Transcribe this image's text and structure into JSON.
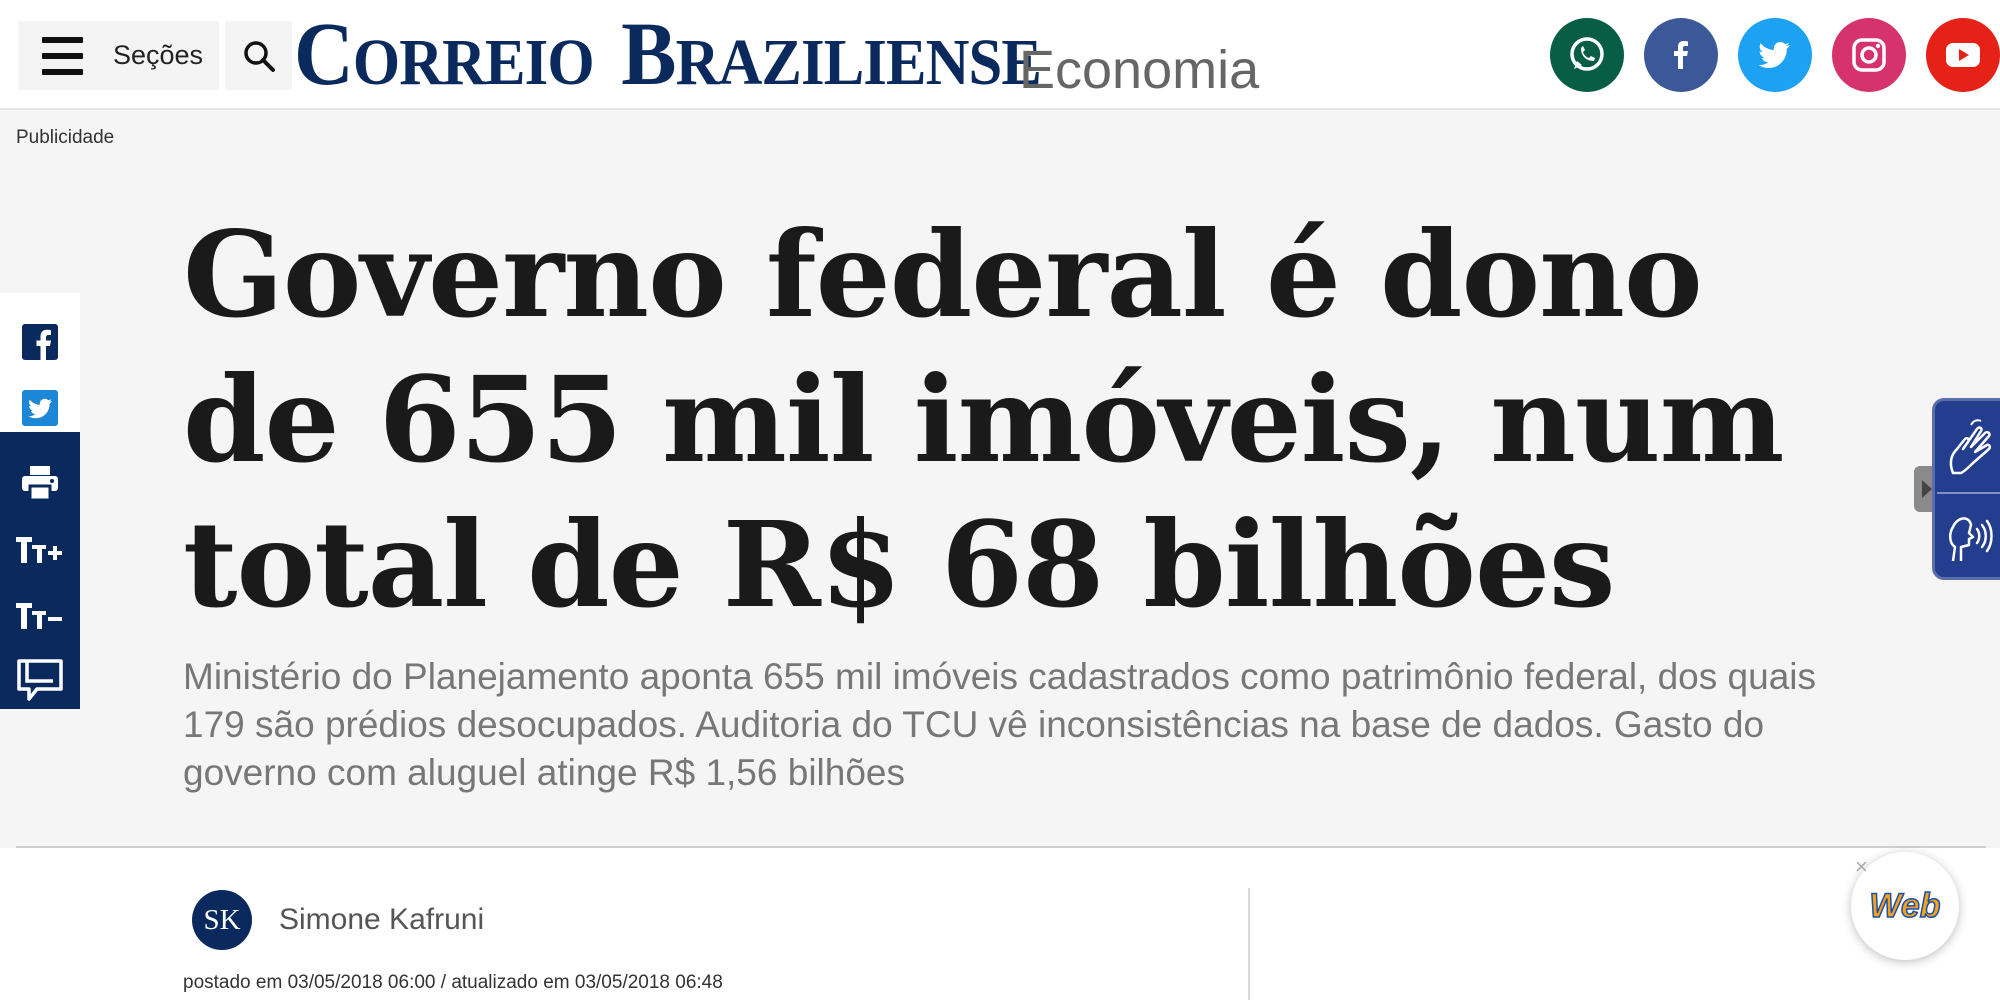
{
  "header": {
    "menu_label": "Seções",
    "logo_word1_initial": "C",
    "logo_word1_rest": "ORREIO",
    "logo_word2_initial": "B",
    "logo_word2_rest": "RAZILIENSE",
    "section_name": "Economia",
    "social_icons": [
      "whatsapp-icon",
      "facebook-icon",
      "twitter-icon",
      "instagram-icon",
      "youtube-icon"
    ]
  },
  "ad": {
    "label": "Publicidade"
  },
  "article": {
    "headline": "Governo federal é dono de 655 mil imóveis, num total de R$ 68 bilhões",
    "subtitle": "Ministério do Planejamento aponta 655 mil imóveis cadastrados como patrimônio federal, dos quais 179 são prédios desocupados. Auditoria do TCU vê inconsistências na base de dados. Gasto do governo com aluguel atinge R$ 1,56 bilhões",
    "author_initials": "SK",
    "author_name": "Simone Kafruni",
    "posted_info": "postado em 03/05/2018 06:00 / atualizado em 03/05/2018 06:48"
  },
  "share_bar": {
    "items": [
      "facebook-share-icon",
      "twitter-share-icon",
      "print-icon",
      "font-increase-icon",
      "font-decrease-icon",
      "comments-icon"
    ]
  },
  "floating_widget": {
    "text": "Web",
    "close": "×"
  },
  "colors": {
    "brand_navy": "#0a2a5e",
    "whatsapp": "#075e45",
    "facebook": "#3b5998",
    "twitter": "#1da1f2",
    "instagram": "#d6336c",
    "youtube": "#e62117",
    "page_bg": "#f5f5f5"
  }
}
